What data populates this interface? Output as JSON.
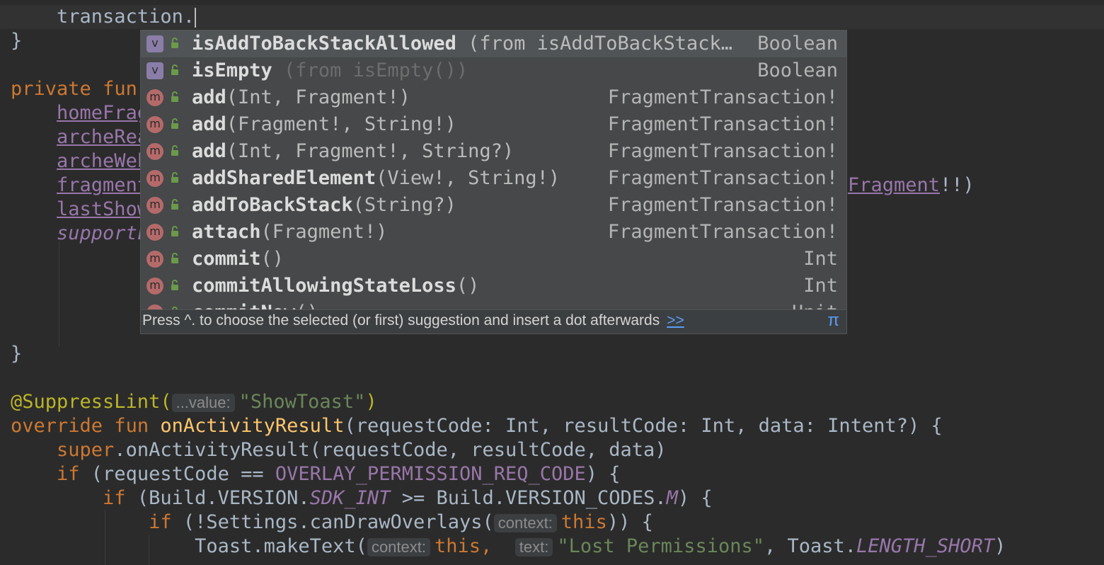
{
  "code": {
    "line_transaction": "transaction.",
    "brace_close_1": "}",
    "private_kw": "private",
    "fun_kw": "fun",
    "home_frag": "homeFrag",
    "arche_rea": "archeRea",
    "arche_web": "archeWeb",
    "fragment_prop": "fragment",
    "last_show": "lastShow",
    "support": "supportF",
    "right_fragment": "Fragment",
    "right_tail": "!!)",
    "brace_close_2": "}",
    "annotation": "@SuppressLint(",
    "hint_value": "...value:",
    "show_toast": "\"ShowToast\"",
    "annotation_end": ")",
    "override_kw": "override",
    "fun_kw2": "fun",
    "on_activity_result": "onActivityResult",
    "params": "(requestCode: Int, resultCode: Int, data: Intent?) {",
    "super_kw": "super",
    "super_call": ".onActivityResult(requestCode, resultCode, data)",
    "if_kw": "if",
    "if_cond_a": " (requestCode == ",
    "overlay_const": "OVERLAY_PERMISSION_REQ_CODE",
    "if_cond_b": ") {",
    "if_kw2": "if",
    "build_a": " (Build.VERSION.",
    "sdk_int": "SDK_INT",
    "build_b": " >= Build.VERSION_CODES.",
    "m_const": "M",
    "build_c": ") {",
    "if_kw3": "if",
    "settings_a": " (!Settings.canDrawOverlays(",
    "hint_context": "context:",
    "this_kw": "this",
    "settings_b": ")) {",
    "toast_a": "Toast.makeText(",
    "hint_context2": "context:",
    "this_kw2": "this",
    "comma": ",",
    "hint_text": "text:",
    "lost_permissions": "\"Lost Permissions\"",
    "toast_b": ", Toast.",
    "length_short": "LENGTH_SHORT",
    "toast_c": ")"
  },
  "completion": {
    "items": [
      {
        "kind": "v",
        "name": "isAddToBackStackAllowed",
        "tail": " (from isAddToBackStack…",
        "tail_dim": false,
        "type": "Boolean"
      },
      {
        "kind": "v",
        "name": "isEmpty",
        "tail": " (from isEmpty())",
        "tail_dim": true,
        "type": "Boolean"
      },
      {
        "kind": "m",
        "name": "add",
        "tail": "(Int, Fragment!)",
        "tail_dim": false,
        "type": "FragmentTransaction!"
      },
      {
        "kind": "m",
        "name": "add",
        "tail": "(Fragment!, String!)",
        "tail_dim": false,
        "type": "FragmentTransaction!"
      },
      {
        "kind": "m",
        "name": "add",
        "tail": "(Int, Fragment!, String?)",
        "tail_dim": false,
        "type": "FragmentTransaction!"
      },
      {
        "kind": "m",
        "name": "addSharedElement",
        "tail": "(View!, String!)",
        "tail_dim": false,
        "type": "FragmentTransaction!"
      },
      {
        "kind": "m",
        "name": "addToBackStack",
        "tail": "(String?)",
        "tail_dim": false,
        "type": "FragmentTransaction!"
      },
      {
        "kind": "m",
        "name": "attach",
        "tail": "(Fragment!)",
        "tail_dim": false,
        "type": "FragmentTransaction!"
      },
      {
        "kind": "m",
        "name": "commit",
        "tail": "()",
        "tail_dim": false,
        "type": "Int"
      },
      {
        "kind": "m",
        "name": "commitAllowingStateLoss",
        "tail": "()",
        "tail_dim": false,
        "type": "Int"
      },
      {
        "kind": "m",
        "name": "commitNow",
        "tail": "()",
        "tail_dim": false,
        "type": "Unit"
      }
    ],
    "footer_text": "Press ^. to choose the selected (or first) suggestion and insert a dot afterwards",
    "footer_link": ">>",
    "footer_icon": "π",
    "lock_icon_glyph": "☰"
  }
}
